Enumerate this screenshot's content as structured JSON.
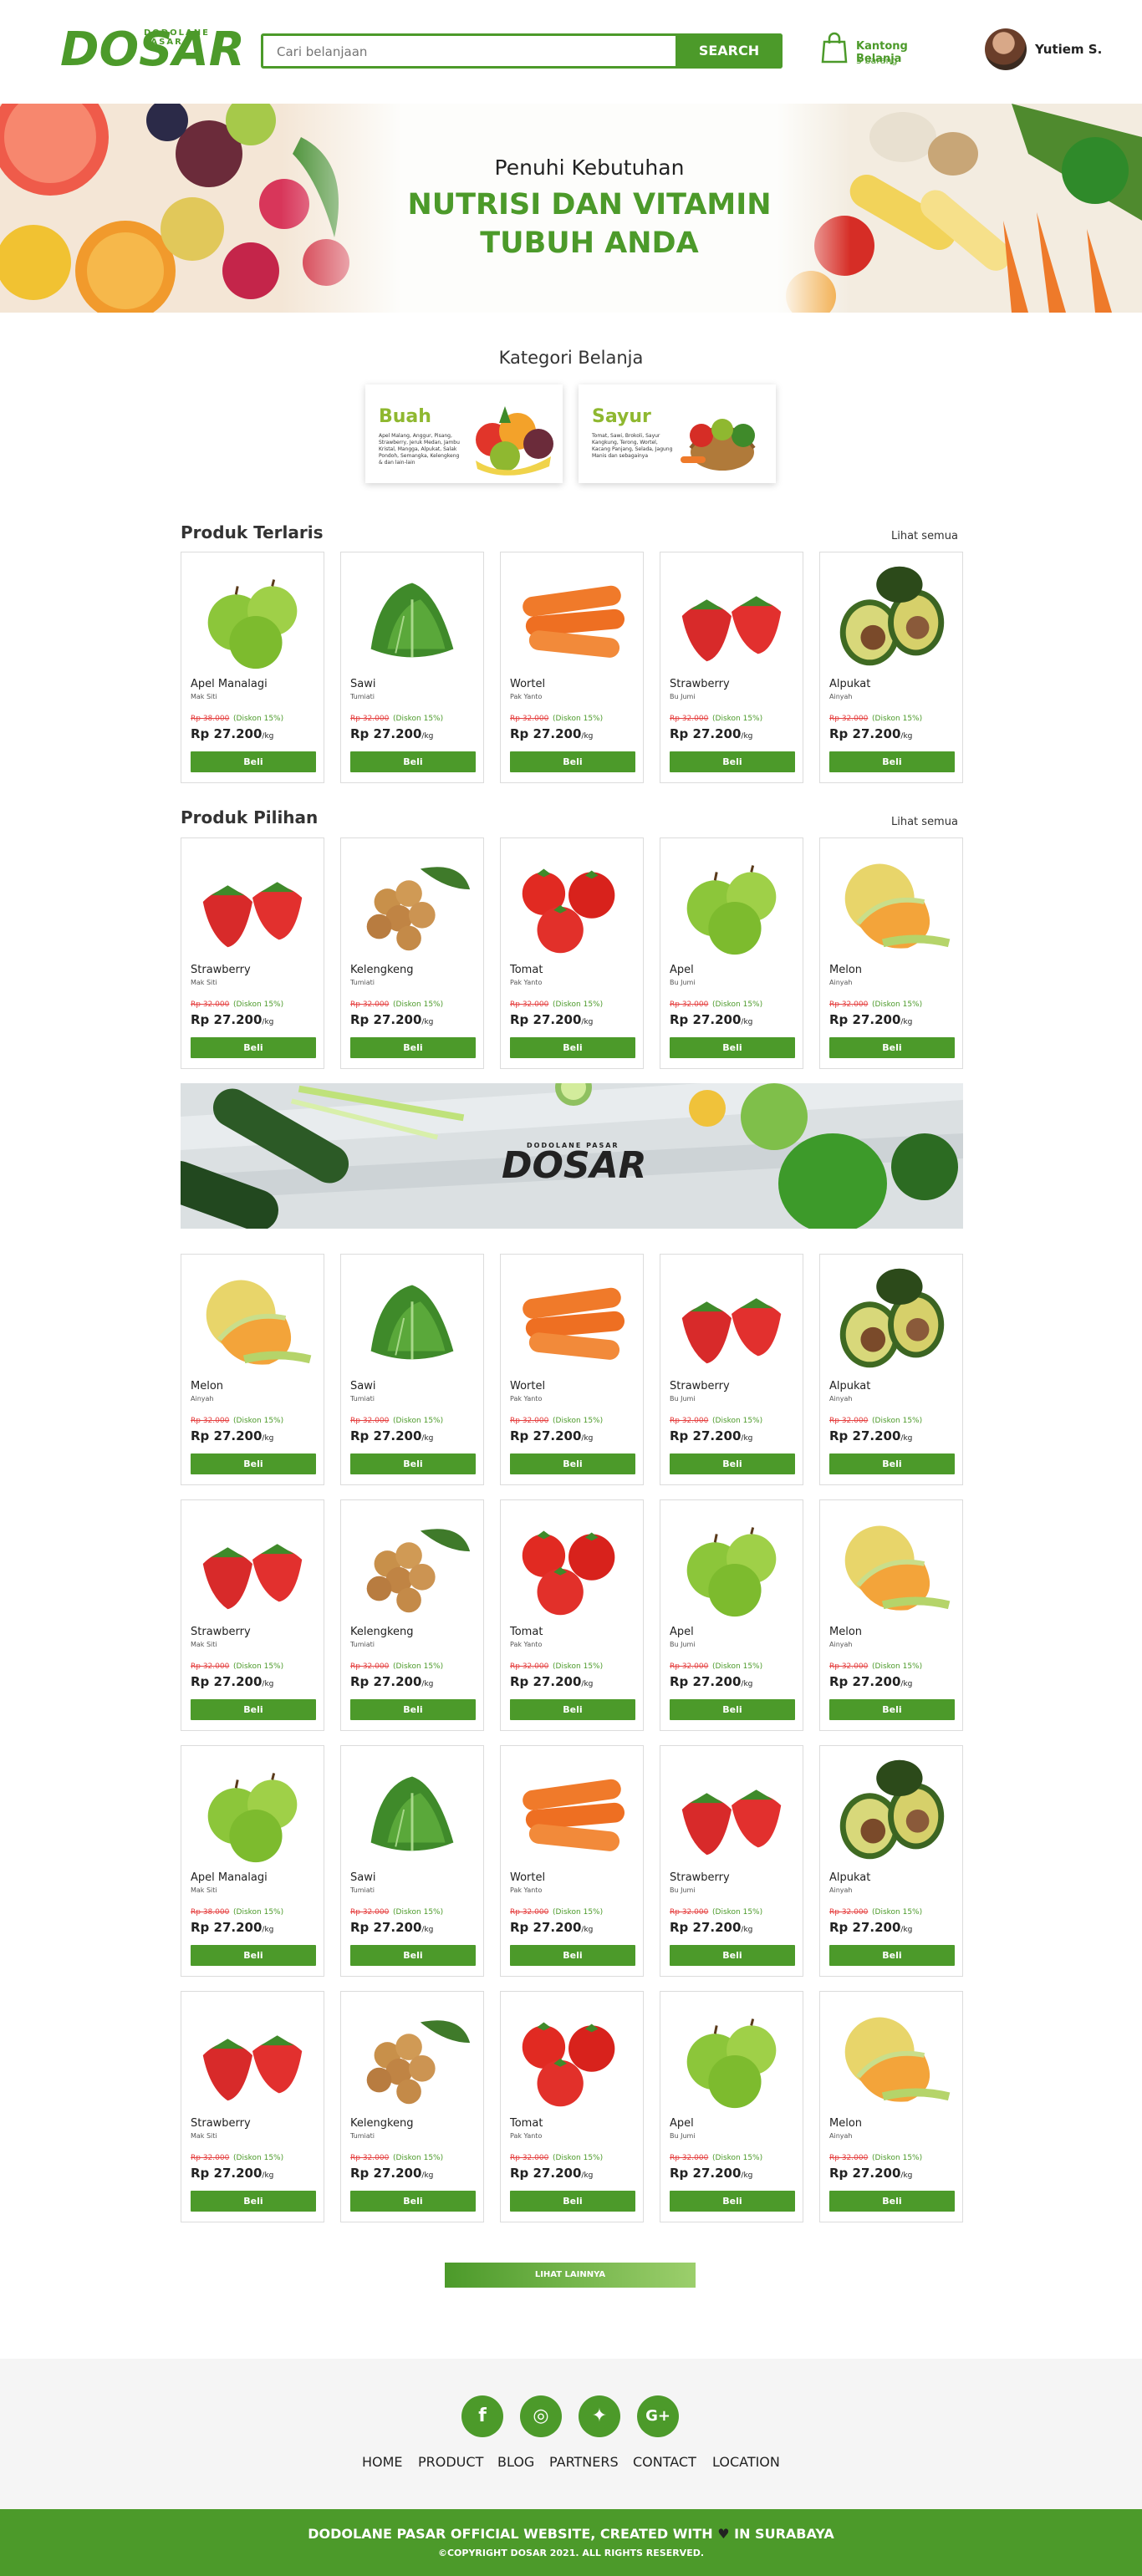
{
  "brand": {
    "name": "DOSAR",
    "tagline": "DODOLANE PASAR",
    "color": "#4c9a2a"
  },
  "header": {
    "search_placeholder": "Cari belanjaan",
    "search_button": "SEARCH",
    "cart_title": "Kantong Belanja",
    "cart_count": "3 barang",
    "user_name": "Yutiem S."
  },
  "hero": {
    "subtitle": "Penuhi Kebutuhan",
    "title": "NUTRISI DAN VITAMIN TUBUH ANDA"
  },
  "categories": {
    "title": "Kategori Belanja",
    "items": [
      {
        "name": "Buah",
        "desc": "Apel Malang, Anggur, Pisang, Strawberry, Jeruk Medan, Jambu Kristal, Mangga, Alpukat, Salak Pondoh, Semangka, Kelengkeng & dan lain-lain",
        "icon": "fruit-basket"
      },
      {
        "name": "Sayur",
        "desc": "Tomat, Sawi, Brokoli, Sayur Kangkung, Terong, Wortel, Kacang Panjang, Selada, Jagung Manis dan sebagainya",
        "icon": "vegetable-basket"
      }
    ]
  },
  "sections": {
    "terlaris": {
      "title": "Produk Terlaris",
      "see_all": "Lihat semua"
    },
    "pilihan": {
      "title": "Produk Pilihan",
      "see_all": "Lihat semua"
    }
  },
  "common": {
    "old_price": "Rp 32.000",
    "discount": "(Diskon 15%)",
    "price": "Rp 27.200",
    "unit": "/kg",
    "buy": "Beli"
  },
  "grids": {
    "terlaris": [
      {
        "name": "Apel Manalagi",
        "seller": "Mak Siti",
        "img": "apple",
        "old": "Rp 38.000"
      },
      {
        "name": "Sawi",
        "seller": "Tumiati",
        "img": "sawi"
      },
      {
        "name": "Wortel",
        "seller": "Pak Yanto",
        "img": "carrot"
      },
      {
        "name": "Strawberry",
        "seller": "Bu Jumi",
        "img": "strawberry"
      },
      {
        "name": "Alpukat",
        "seller": "Ainyah",
        "img": "avocado"
      }
    ],
    "pilihan": [
      {
        "name": "Strawberry",
        "seller": "Mak Siti",
        "img": "strawberry"
      },
      {
        "name": "Kelengkeng",
        "seller": "Tumiati",
        "img": "longan"
      },
      {
        "name": "Tomat",
        "seller": "Pak Yanto",
        "img": "tomato"
      },
      {
        "name": "Apel",
        "seller": "Bu Jumi",
        "img": "apple"
      },
      {
        "name": "Melon",
        "seller": "Ainyah",
        "img": "melon"
      }
    ],
    "row3": [
      {
        "name": "Melon",
        "seller": "Ainyah",
        "img": "melon"
      },
      {
        "name": "Sawi",
        "seller": "Tumiati",
        "img": "sawi"
      },
      {
        "name": "Wortel",
        "seller": "Pak Yanto",
        "img": "carrot"
      },
      {
        "name": "Strawberry",
        "seller": "Bu Jumi",
        "img": "strawberry"
      },
      {
        "name": "Alpukat",
        "seller": "Ainyah",
        "img": "avocado"
      }
    ],
    "row4": [
      {
        "name": "Strawberry",
        "seller": "Mak Siti",
        "img": "strawberry"
      },
      {
        "name": "Kelengkeng",
        "seller": "Tumiati",
        "img": "longan"
      },
      {
        "name": "Tomat",
        "seller": "Pak Yanto",
        "img": "tomato"
      },
      {
        "name": "Apel",
        "seller": "Bu Jumi",
        "img": "apple"
      },
      {
        "name": "Melon",
        "seller": "Ainyah",
        "img": "melon"
      }
    ],
    "row5": [
      {
        "name": "Apel Manalagi",
        "seller": "Mak Siti",
        "img": "apple",
        "old": "Rp 38.000"
      },
      {
        "name": "Sawi",
        "seller": "Tumiati",
        "img": "sawi"
      },
      {
        "name": "Wortel",
        "seller": "Pak Yanto",
        "img": "carrot"
      },
      {
        "name": "Strawberry",
        "seller": "Bu Jumi",
        "img": "strawberry"
      },
      {
        "name": "Alpukat",
        "seller": "Ainyah",
        "img": "avocado"
      }
    ],
    "row6": [
      {
        "name": "Strawberry",
        "seller": "Mak Siti",
        "img": "strawberry"
      },
      {
        "name": "Kelengkeng",
        "seller": "Tumiati",
        "img": "longan"
      },
      {
        "name": "Tomat",
        "seller": "Pak Yanto",
        "img": "tomato"
      },
      {
        "name": "Apel",
        "seller": "Bu Jumi",
        "img": "apple"
      },
      {
        "name": "Melon",
        "seller": "Ainyah",
        "img": "melon"
      }
    ]
  },
  "load_more": "LIHAT LAINNYA",
  "footer": {
    "social": [
      {
        "icon": "facebook-icon",
        "glyph": "f"
      },
      {
        "icon": "instagram-icon",
        "glyph": "◎"
      },
      {
        "icon": "twitter-icon",
        "glyph": "✦"
      },
      {
        "icon": "google-plus-icon",
        "glyph": "G+"
      }
    ],
    "nav": [
      "HOME",
      "PRODUCT",
      "BLOG",
      "PARTNERS",
      "CONTACT",
      "LOCATION"
    ],
    "credit_prefix": "DODOLANE PASAR OFFICIAL WEBSITE, CREATED WITH",
    "credit_suffix": "IN SURABAYA",
    "copyright": "©COPYRIGHT DOSAR 2021. ALL RIGHTS RESERVED."
  }
}
